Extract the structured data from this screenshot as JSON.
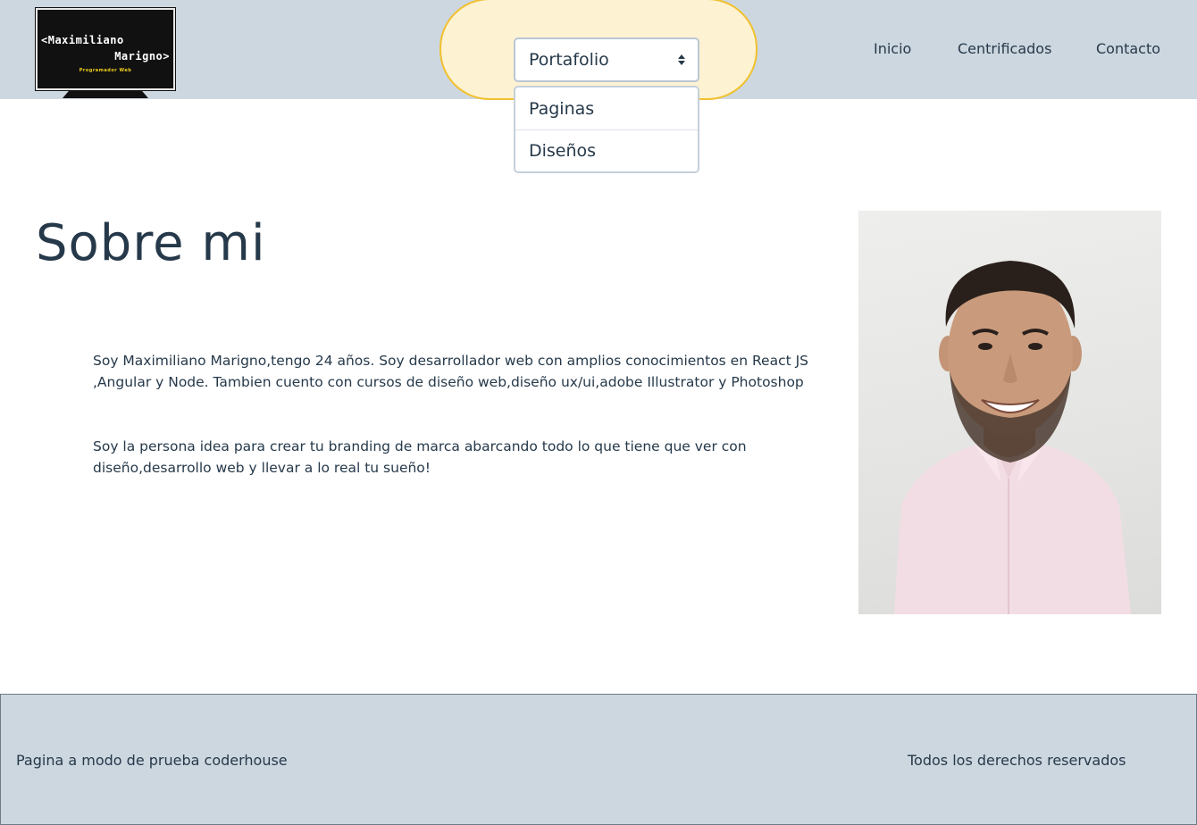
{
  "logo": {
    "line1": "<Maximiliano",
    "line2": "Marigno>",
    "subtitle": "Programador Web"
  },
  "dropdown": {
    "selected": "Portafolio",
    "options": [
      "Paginas",
      "Diseños"
    ]
  },
  "nav": [
    "Inicio",
    "Centrificados",
    "Contacto"
  ],
  "main": {
    "title": "Sobre mi",
    "paragraphs": [
      "Soy Maximiliano Marigno,tengo 24 años. Soy desarrollador web con amplios conocimientos en React JS ,Angular y Node. Tambien cuento con cursos de diseño web,diseño ux/ui,adobe Illustrator y Photoshop",
      "Soy la persona idea para crear tu branding de marca abarcando todo lo que tiene que ver con diseño,desarrollo web y llevar a lo real tu sueño!"
    ]
  },
  "footer": {
    "left": "Pagina a modo de prueba coderhouse",
    "right": "Todos los derechos reservados"
  },
  "colors": {
    "header_bg": "#cdd7e0",
    "pill_bg": "#fdf2d2",
    "pill_border": "#f0c12f",
    "text": "#26394a"
  }
}
